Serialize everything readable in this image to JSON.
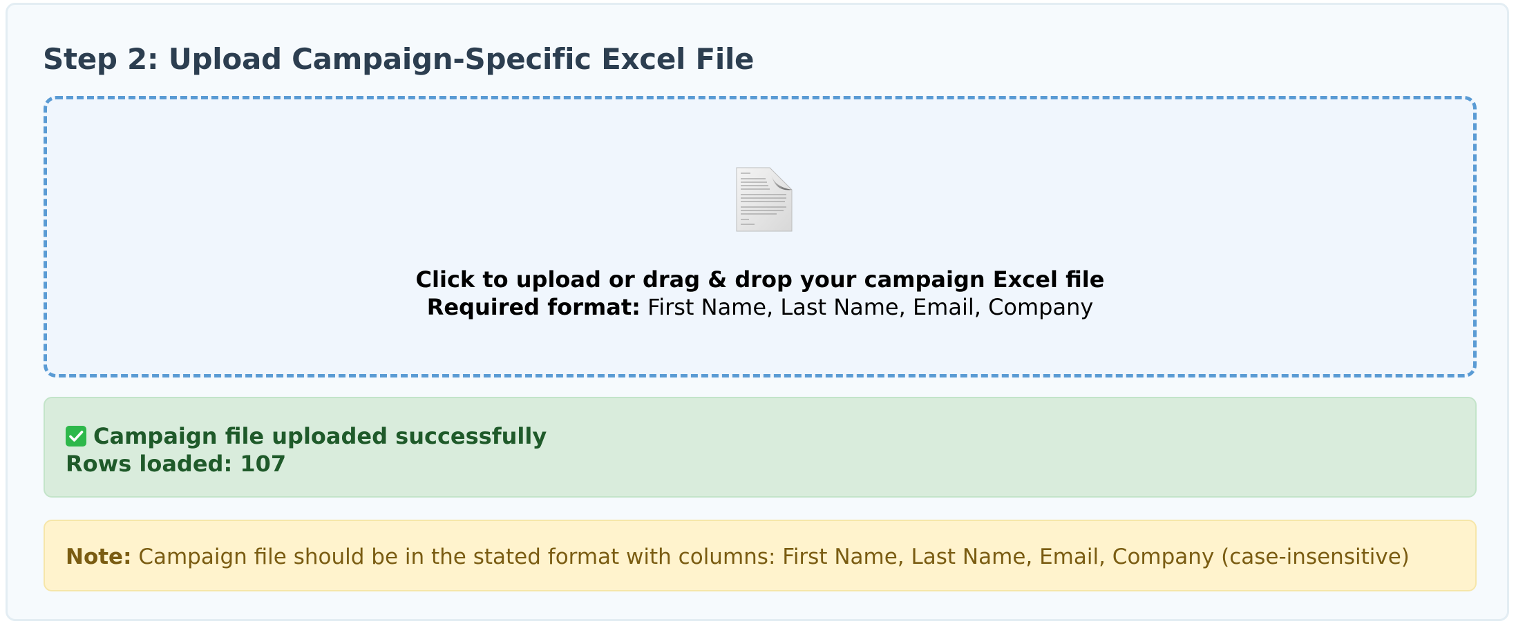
{
  "step": {
    "title": "Step 2: Upload Campaign-Specific Excel File"
  },
  "dropzone": {
    "icon": "document-icon",
    "main_text": "Click to upload or drag & drop your campaign Excel file",
    "format_label": "Required format:",
    "format_value": " First Name, Last Name, Email, Company"
  },
  "status": {
    "icon": "check-mark-icon",
    "message": "Campaign file uploaded successfully",
    "rows_text": "Rows loaded: 107"
  },
  "note": {
    "label": "Note:",
    "text": " Campaign file should be in the stated format with columns: First Name, Last Name, Email, Company (case-insensitive)"
  },
  "colors": {
    "dropzone_border": "#5a9bd4",
    "success_bg": "#d9ecdc",
    "success_text": "#1f5a2a",
    "note_bg": "#fff3cd",
    "note_text": "#7a5c12",
    "title": "#2c3e50"
  }
}
